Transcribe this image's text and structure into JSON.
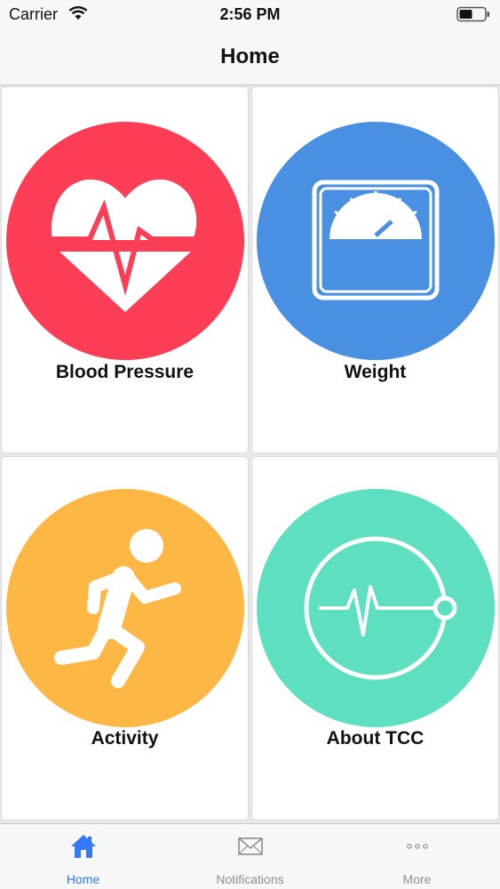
{
  "status_bar": {
    "carrier": "Carrier",
    "time": "2:56 PM",
    "wifi_icon": "wifi-icon",
    "battery_icon": "battery-icon"
  },
  "nav": {
    "title": "Home"
  },
  "tiles": [
    {
      "label": "Blood Pressure",
      "icon": "heart-pulse-icon",
      "color": "#fc3d56"
    },
    {
      "label": "Weight",
      "icon": "scale-icon",
      "color": "#4a90e2"
    },
    {
      "label": "Activity",
      "icon": "running-person-icon",
      "color": "#fcb744"
    },
    {
      "label": "About TCC",
      "icon": "pulse-circle-icon",
      "color": "#5ee0c0"
    }
  ],
  "tab_bar": {
    "tabs": [
      {
        "label": "Home",
        "icon": "house-icon",
        "selected": true
      },
      {
        "label": "Notifications",
        "icon": "envelope-icon",
        "selected": false
      },
      {
        "label": "More",
        "icon": "more-dots-icon",
        "selected": false
      }
    ],
    "active_color": "#3478f6",
    "inactive_color": "#8e8e93"
  }
}
